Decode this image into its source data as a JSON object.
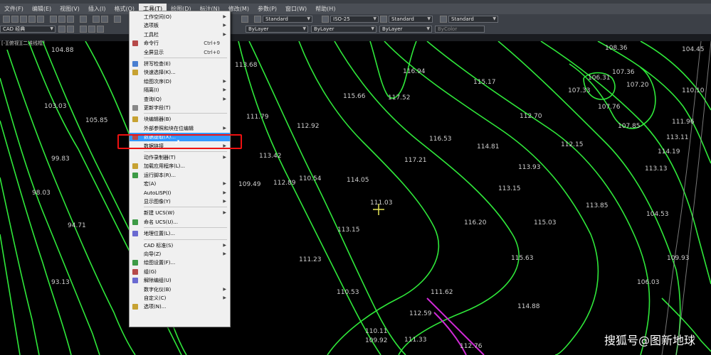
{
  "menubar": {
    "items": [
      "文件(F)",
      "编辑(E)",
      "视图(V)",
      "插入(I)",
      "格式(O)",
      "工具(T)",
      "绘图(D)",
      "标注(N)",
      "修改(M)",
      "参数(P)",
      "窗口(W)",
      "帮助(H)"
    ],
    "active_index": 5
  },
  "toolbar": {
    "workspace": "CAD 经典",
    "text_style": "Standard",
    "dim_style": "ISO-25",
    "table_style": "Standard",
    "layer_color": "ByLayer",
    "linetype": "ByLayer",
    "lineweight": "ByLayer",
    "plot_style": "ByColor"
  },
  "tab_label": "[-][俯视][二维线框]",
  "tools_menu": [
    {
      "label": "工作空间(O)",
      "submenu": true
    },
    {
      "label": "选项板",
      "submenu": true
    },
    {
      "label": "工具栏",
      "submenu": true
    },
    {
      "label": "命令行",
      "shortcut": "Ctrl+9",
      "icon": "command-line-icon"
    },
    {
      "label": "全屏显示",
      "shortcut": "Ctrl+0"
    },
    {
      "sep": true
    },
    {
      "label": "拼写检查(E)",
      "icon": "spell-check-icon"
    },
    {
      "label": "快速选择(K)...",
      "icon": "quick-select-icon"
    },
    {
      "label": "绘图次序(D)",
      "submenu": true
    },
    {
      "label": "隔离(I)",
      "submenu": true
    },
    {
      "label": "查询(Q)",
      "submenu": true
    },
    {
      "label": "更新字段(T)",
      "icon": "update-field-icon"
    },
    {
      "sep": true
    },
    {
      "label": "块编辑器(B)",
      "icon": "block-editor-icon"
    },
    {
      "label": "外部参照和块在位编辑",
      "submenu": true
    },
    {
      "label": "数据提取(X)...",
      "icon": "data-extraction-icon",
      "highlighted": true
    },
    {
      "label": "数据链接",
      "submenu": true
    },
    {
      "sep": true
    },
    {
      "label": "动作录制器(T)",
      "submenu": true
    },
    {
      "label": "加载应用程序(L)...",
      "icon": "load-app-icon"
    },
    {
      "label": "运行脚本(R)...",
      "icon": "run-script-icon"
    },
    {
      "label": "宏(A)",
      "submenu": true
    },
    {
      "label": "AutoLISP(I)",
      "submenu": true
    },
    {
      "label": "显示图像(Y)",
      "submenu": true
    },
    {
      "sep": true
    },
    {
      "label": "新建 UCS(W)",
      "submenu": true
    },
    {
      "label": "命名 UCS(U)...",
      "icon": "named-ucs-icon"
    },
    {
      "sep": true
    },
    {
      "label": "地理位置(L)...",
      "icon": "geolocation-icon"
    },
    {
      "sep": true
    },
    {
      "label": "CAD 标准(S)",
      "submenu": true
    },
    {
      "label": "向导(Z)",
      "submenu": true
    },
    {
      "label": "绘图设置(F)...",
      "icon": "drafting-settings-icon"
    },
    {
      "label": "组(G)",
      "icon": "group-icon"
    },
    {
      "label": "解除编组(U)",
      "icon": "ungroup-icon"
    },
    {
      "label": "数字化仪(B)",
      "submenu": true
    },
    {
      "label": "自定义(C)",
      "submenu": true
    },
    {
      "label": "选项(N)...",
      "icon": "options-icon"
    }
  ],
  "contour_labels": [
    "104.88",
    "103.03",
    "105.85",
    "99.83",
    "98.03",
    "94.71",
    "93.13",
    "113.68",
    "116.94",
    "115.66",
    "117.52",
    "115.17",
    "111.79",
    "112.92",
    "113.42",
    "109.49",
    "112.89",
    "110.54",
    "114.05",
    "111.03",
    "117.21",
    "116.53",
    "114.81",
    "113.93",
    "113.15",
    "113.85",
    "116.20",
    "115.03",
    "113.15",
    "111.23",
    "115.63",
    "110.53",
    "111.62",
    "114.88",
    "112.59",
    "110.11",
    "109.92",
    "111.33",
    "112.76",
    "109.93",
    "108.36",
    "107.36",
    "106.31",
    "107.33",
    "107.76",
    "107.20",
    "107.85",
    "104.45",
    "110.10",
    "111.96",
    "113.11",
    "114.19",
    "113.13",
    "112.70",
    "112.15",
    "104.53",
    "106.03"
  ],
  "watermark": "搜狐号@图新地球",
  "colors": {
    "contour": "#2fe83a",
    "menu_highlight": "#3399ff",
    "annotation_box": "#e11111",
    "magenta": "#d02ad6"
  }
}
